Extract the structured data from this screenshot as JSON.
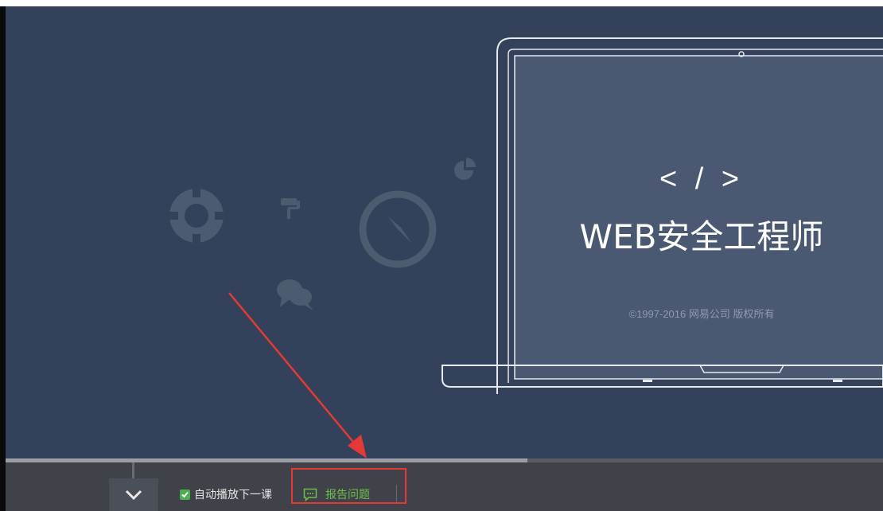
{
  "video": {
    "code_glyph": "< / >",
    "course_title": "WEB安全工程师",
    "copyright": "©1997-2016 网易公司 版权所有",
    "icons": [
      "lifebuoy-icon",
      "paint-roller-icon",
      "compass-icon",
      "pie-chart-icon",
      "chat-bubbles-icon",
      "laptop-icon"
    ]
  },
  "player": {
    "progress_fraction": 0.595,
    "autoplay": {
      "label": "自动播放下一课",
      "checked": true
    },
    "report": {
      "label": "报告问题",
      "icon": "message-icon"
    },
    "toggle_icon": "chevron-down-icon"
  },
  "annotation": {
    "highlight_color": "#e53935",
    "arrow_color": "#e53935"
  },
  "colors": {
    "video_bg": "#33415a",
    "bar_bg": "#3f4249",
    "report_green": "#6cc04a",
    "checkbox_green": "#4caf50"
  }
}
